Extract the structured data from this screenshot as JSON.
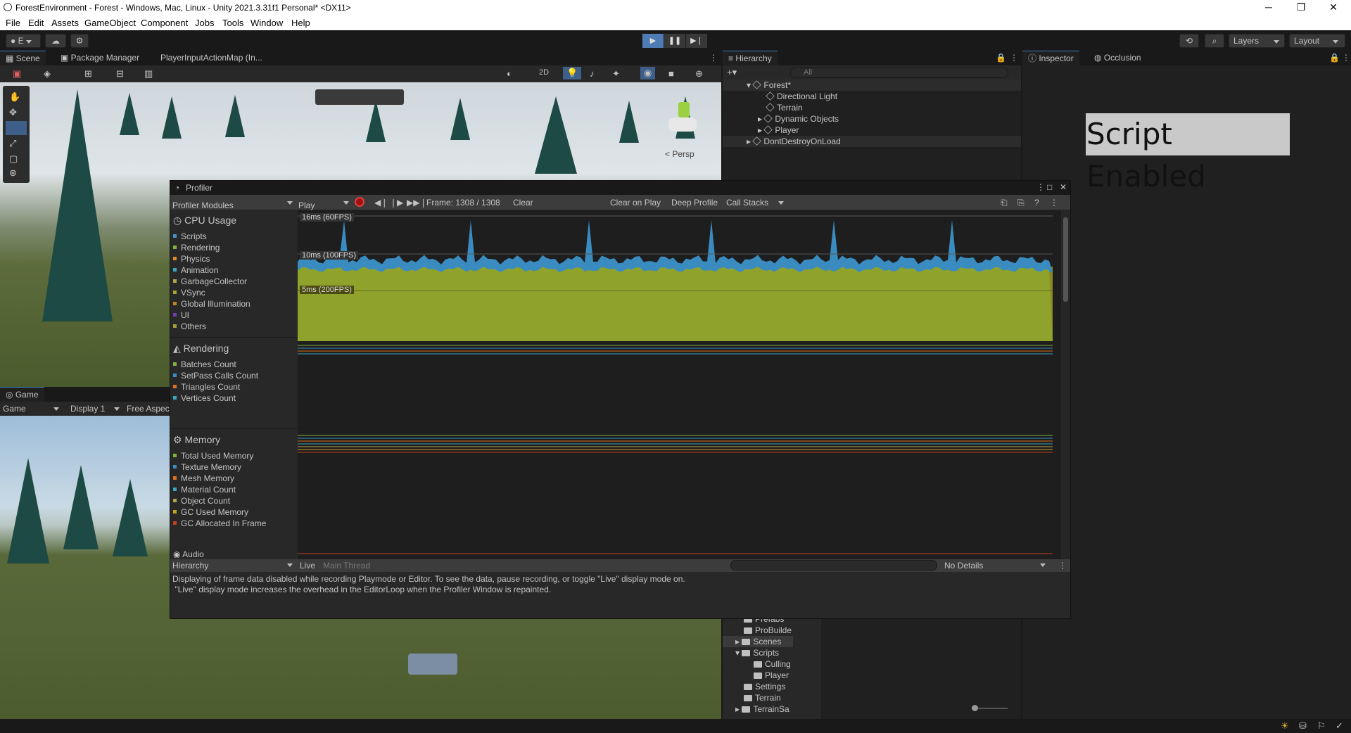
{
  "window": {
    "title": "ForestEnvironment - Forest - Windows, Mac, Linux - Unity 2021.3.31f1 Personal* <DX11>",
    "minimize": "─",
    "maximize": "❐",
    "close": "✕"
  },
  "menu": [
    "File",
    "Edit",
    "Assets",
    "GameObject",
    "Component",
    "Jobs",
    "Tools",
    "Window",
    "Help"
  ],
  "toolbar": {
    "account": "E",
    "layers": "Layers",
    "layout": "Layout"
  },
  "scene_tabs": [
    "Scene",
    "Package Manager",
    "PlayerInputActionMap (In..."
  ],
  "scene_toolbar": {
    "mode2d": "2D",
    "persp": "< Persp"
  },
  "game_tab": {
    "label": "Game",
    "display_mode": "Game",
    "display": "Display 1",
    "aspect": "Free Aspect"
  },
  "hierarchy": {
    "tab": "Hierarchy",
    "search_placeholder": "All",
    "items": [
      {
        "label": "Forest*"
      },
      {
        "label": "Directional Light"
      },
      {
        "label": "Terrain"
      },
      {
        "label": "Dynamic Objects"
      },
      {
        "label": "Player"
      },
      {
        "label": "DontDestroyOnLoad"
      }
    ]
  },
  "inspector": {
    "tab": "Inspector",
    "occlusion_tab": "Occlusion",
    "overlay_text": "Script Enabled"
  },
  "profiler": {
    "title": "Profiler",
    "modules_dropdown": "Profiler Modules",
    "play_mode": "Play Mode",
    "frame": "Frame: 1308 / 1308",
    "clear": "Clear",
    "clear_on_play": "Clear on Play",
    "deep_profile": "Deep Profile",
    "call_stacks": "Call Stacks",
    "cpu": {
      "title": "CPU Usage",
      "items": [
        "Scripts",
        "Rendering",
        "Physics",
        "Animation",
        "GarbageCollector",
        "VSync",
        "Global Illumination",
        "UI",
        "Others"
      ],
      "colors": [
        "#4a90c8",
        "#7fb33a",
        "#e08a24",
        "#3aa6c0",
        "#b4a44a",
        "#a9a630",
        "#c58220",
        "#6f3bb0",
        "#a69e3a"
      ],
      "markers": [
        "16ms (60FPS)",
        "10ms (100FPS)",
        "5ms (200FPS)"
      ]
    },
    "rendering": {
      "title": "Rendering",
      "items": [
        "Batches Count",
        "SetPass Calls Count",
        "Triangles Count",
        "Vertices Count"
      ],
      "colors": [
        "#7fb33a",
        "#3a8cc0",
        "#e0701f",
        "#3aa6c0"
      ]
    },
    "memory": {
      "title": "Memory",
      "items": [
        "Total Used Memory",
        "Texture Memory",
        "Mesh Memory",
        "Material Count",
        "Object Count",
        "GC Used Memory",
        "GC Allocated In Frame"
      ],
      "colors": [
        "#7fb33a",
        "#3a8cc0",
        "#e0701f",
        "#3aa6c0",
        "#b4a44a",
        "#c8a020",
        "#c04020"
      ]
    },
    "audio_title": "Audio",
    "bottom": {
      "view": "Hierarchy",
      "live": "Live",
      "thread": "Main Thread",
      "details": "No Details"
    },
    "message": [
      "Displaying of frame data disabled while recording Playmode or Editor. To see the data, pause recording, or toggle \"Live\" display mode on.",
      " \"Live\" display mode increases the overhead in the EditorLoop when the Profiler Window is repainted."
    ]
  },
  "project_folders": [
    "Prefabs",
    "ProBuilde",
    "Scenes",
    "Scripts",
    "Culling",
    "Player",
    "Settings",
    "Terrain",
    "TerrainSa"
  ]
}
